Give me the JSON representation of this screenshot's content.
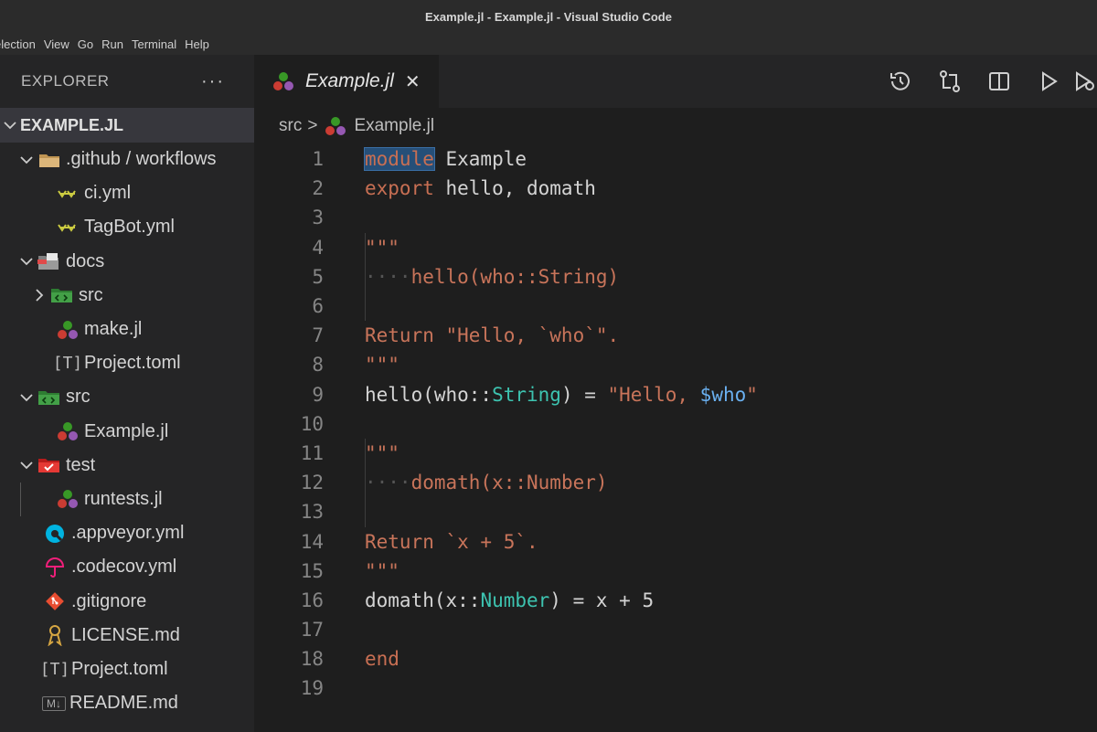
{
  "window": {
    "title": "Example.jl - Example.jl - Visual Studio Code"
  },
  "menu": [
    "election",
    "View",
    "Go",
    "Run",
    "Terminal",
    "Help"
  ],
  "explorer": {
    "header": "EXPLORER",
    "more": "···",
    "root": "EXAMPLE.JL",
    "items": [
      {
        "label": ".github / workflows",
        "icon": "folder-icon"
      },
      {
        "label": "ci.yml",
        "icon": "yaml-icon"
      },
      {
        "label": "TagBot.yml",
        "icon": "yaml-icon"
      },
      {
        "label": "docs",
        "icon": "docs-folder-icon"
      },
      {
        "label": "src",
        "icon": "src-folder-icon"
      },
      {
        "label": "make.jl",
        "icon": "julia-icon"
      },
      {
        "label": "Project.toml",
        "icon": "toml-icon"
      },
      {
        "label": "src",
        "icon": "src-folder-icon"
      },
      {
        "label": "Example.jl",
        "icon": "julia-icon"
      },
      {
        "label": "test",
        "icon": "test-folder-icon"
      },
      {
        "label": "runtests.jl",
        "icon": "julia-icon"
      },
      {
        "label": ".appveyor.yml",
        "icon": "appveyor-icon"
      },
      {
        "label": ".codecov.yml",
        "icon": "codecov-icon"
      },
      {
        "label": ".gitignore",
        "icon": "git-icon"
      },
      {
        "label": "LICENSE.md",
        "icon": "license-icon"
      },
      {
        "label": "Project.toml",
        "icon": "toml-icon"
      },
      {
        "label": "README.md",
        "icon": "markdown-icon"
      }
    ],
    "toml_glyph": "[T]",
    "md_glyph": "M↓"
  },
  "editor": {
    "tab": {
      "label": "Example.jl",
      "close": "✕"
    },
    "breadcrumb": {
      "folder": "src",
      "sep": ">",
      "file": "Example.jl"
    },
    "colors": {
      "keyword": "#c86f53",
      "type": "#3dc3b0",
      "interp": "#6ab0f0",
      "julia_red": "#cb3c33",
      "julia_green": "#389826",
      "julia_purple": "#9558b2"
    },
    "lines": [
      {
        "n": "1",
        "tokens": [
          "module",
          " Example"
        ]
      },
      {
        "n": "2",
        "tokens": [
          "export",
          " hello, domath"
        ]
      },
      {
        "n": "3",
        "tokens": []
      },
      {
        "n": "4",
        "tokens": [
          "\"\"\""
        ]
      },
      {
        "n": "5",
        "tokens": [
          "····",
          "hello(who::String)"
        ]
      },
      {
        "n": "6",
        "tokens": []
      },
      {
        "n": "7",
        "tokens": [
          "Return \"Hello, `who`\"."
        ]
      },
      {
        "n": "8",
        "tokens": [
          "\"\"\""
        ]
      },
      {
        "n": "9",
        "tokens": [
          "hello(who::",
          "String",
          ") = ",
          "\"Hello, ",
          "$who",
          "\""
        ]
      },
      {
        "n": "10",
        "tokens": []
      },
      {
        "n": "11",
        "tokens": [
          "\"\"\""
        ]
      },
      {
        "n": "12",
        "tokens": [
          "····",
          "domath(x::Number)"
        ]
      },
      {
        "n": "13",
        "tokens": []
      },
      {
        "n": "14",
        "tokens": [
          "Return `x + 5`."
        ]
      },
      {
        "n": "15",
        "tokens": [
          "\"\"\""
        ]
      },
      {
        "n": "16",
        "tokens": [
          "domath(x::",
          "Number",
          ") = x + 5"
        ]
      },
      {
        "n": "17",
        "tokens": []
      },
      {
        "n": "18",
        "tokens": [
          "end"
        ]
      },
      {
        "n": "19",
        "tokens": []
      }
    ]
  }
}
